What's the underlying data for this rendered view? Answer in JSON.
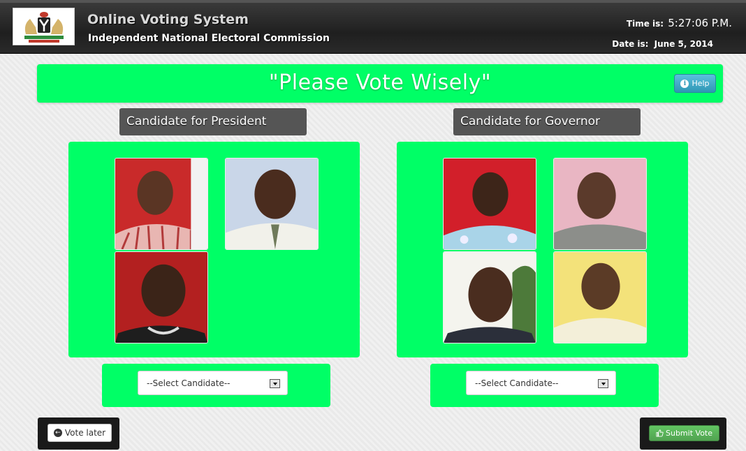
{
  "header": {
    "logo_icon": "coat-of-arms-logo",
    "title": "Online Voting System",
    "subtitle": "Independent National Electoral Commission",
    "time_label": "Time is:",
    "time_value": "5:27:06 P.M.",
    "date_label": "Date is:",
    "date_value": "June 5, 2014"
  },
  "banner": {
    "text": "\"Please Vote Wisely\"",
    "help_label": "Help",
    "help_icon": "info-icon"
  },
  "president": {
    "label": "Candidate for President",
    "select_value": "--Select Candidate--",
    "candidates": [
      {
        "icon": "candidate-photo",
        "bg": "#c92a2a"
      },
      {
        "icon": "candidate-photo",
        "bg": "#c9d6e8"
      },
      {
        "icon": "candidate-photo",
        "bg": "#b32020"
      }
    ]
  },
  "governor": {
    "label": "Candidate for Governor",
    "select_value": "--Select Candidate--",
    "candidates": [
      {
        "icon": "candidate-photo",
        "bg": "#d21f2a"
      },
      {
        "icon": "candidate-photo",
        "bg": "#e9b6c3"
      },
      {
        "icon": "candidate-photo",
        "bg": "#f4f4ee"
      },
      {
        "icon": "candidate-photo",
        "bg": "#f3e27a"
      }
    ]
  },
  "footer": {
    "vote_later_label": "Vote later",
    "vote_later_icon": "arrow-left-circle-icon",
    "submit_label": "Submit Vote",
    "submit_icon": "thumbs-up-icon"
  },
  "colors": {
    "accent_green": "#00ff66",
    "header_dark": "#2a2a2a",
    "label_gray": "#555555",
    "help_blue": "#2f96b4",
    "submit_green": "#51a351"
  }
}
